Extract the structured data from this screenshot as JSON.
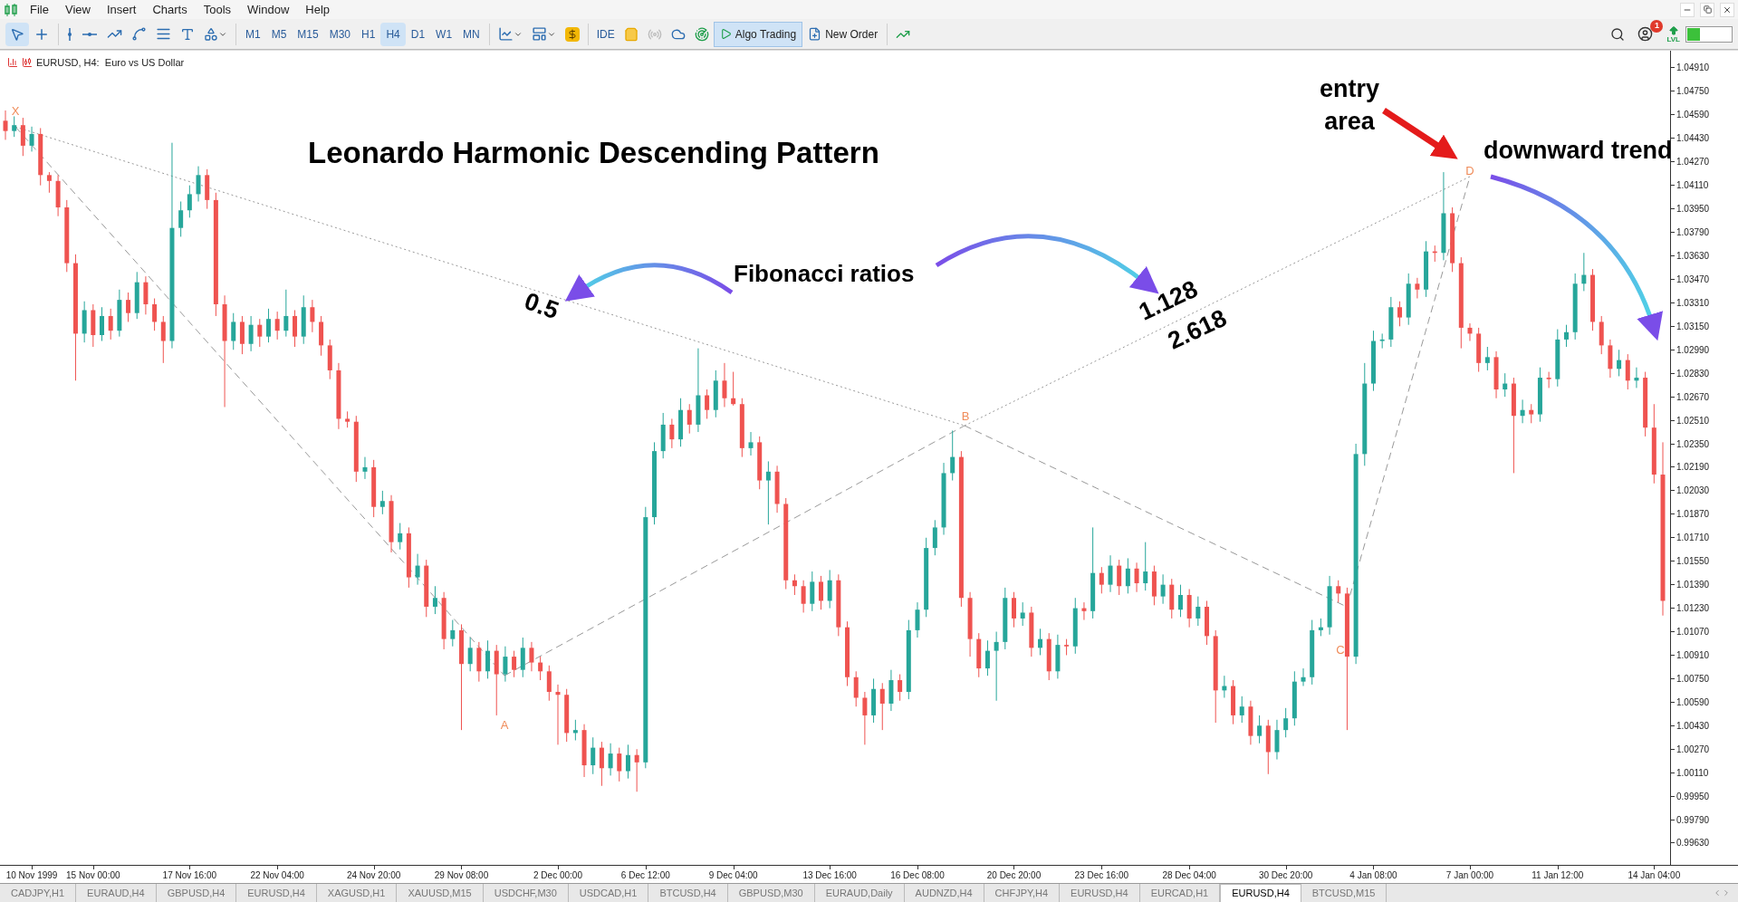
{
  "menu": [
    "File",
    "View",
    "Insert",
    "Charts",
    "Tools",
    "Window",
    "Help"
  ],
  "toolbar": {
    "timeframes": [
      {
        "label": "M1",
        "selected": false
      },
      {
        "label": "M5",
        "selected": false
      },
      {
        "label": "M15",
        "selected": false
      },
      {
        "label": "M30",
        "selected": false
      },
      {
        "label": "H1",
        "selected": false
      },
      {
        "label": "H4",
        "selected": true
      },
      {
        "label": "D1",
        "selected": false
      },
      {
        "label": "W1",
        "selected": false
      },
      {
        "label": "MN",
        "selected": false
      }
    ],
    "ide": "IDE",
    "algo_trading": {
      "label": "Algo Trading",
      "on": true
    },
    "new_order": "New Order",
    "notification_count": "1",
    "level_badge": "LVL",
    "meter": {
      "level": 0.3
    }
  },
  "chart": {
    "header": "EURUSD, H4:  Euro vs US Dollar",
    "title": "Leonardo Harmonic Descending Pattern",
    "fib_label": "Fibonacci ratios",
    "entry_label": [
      "entry",
      "area"
    ],
    "trend_label": "downward trend",
    "ratios": [
      "0.5",
      "1.128",
      "2.618"
    ],
    "points": [
      "X",
      "A",
      "B",
      "C",
      "D"
    ],
    "chart_data": {
      "type": "candlestick",
      "ylim": [
        0.99488,
        1.05027
      ],
      "categories": [
        null,
        null,
        null,
        "10 Nov 1999",
        null,
        null,
        null,
        null,
        null,
        null,
        "15 Nov 00:00",
        null,
        null,
        null,
        null,
        null,
        null,
        null,
        null,
        null,
        null,
        "17 Nov 16:00",
        null,
        null,
        null,
        null,
        null,
        null,
        null,
        null,
        null,
        "22 Nov 04:00",
        null,
        null,
        null,
        null,
        null,
        null,
        null,
        null,
        null,
        null,
        "24 Nov 20:00",
        null,
        null,
        null,
        null,
        null,
        null,
        null,
        null,
        null,
        "29 Nov 08:00",
        null,
        null,
        null,
        null,
        null,
        null,
        null,
        null,
        null,
        null,
        "2 Dec 00:00",
        null,
        null,
        null,
        null,
        null,
        null,
        null,
        null,
        null,
        "6 Dec 12:00",
        null,
        null,
        null,
        null,
        null,
        null,
        null,
        null,
        null,
        "9 Dec 04:00",
        null,
        null,
        null,
        null,
        null,
        null,
        null,
        null,
        null,
        null,
        "13 Dec 16:00",
        null,
        null,
        null,
        null,
        null,
        null,
        null,
        null,
        null,
        "16 Dec 08:00",
        null,
        null,
        null,
        null,
        null,
        null,
        null,
        null,
        null,
        null,
        "20 Dec 20:00",
        null,
        null,
        null,
        null,
        null,
        null,
        null,
        null,
        null,
        "23 Dec 16:00",
        null,
        null,
        null,
        null,
        null,
        null,
        null,
        null,
        null,
        "28 Dec 04:00",
        null,
        null,
        null,
        null,
        null,
        null,
        null,
        null,
        null,
        null,
        "30 Dec 20:00",
        null,
        null,
        null,
        null,
        null,
        null,
        null,
        null,
        null,
        "4 Jan 08:00",
        null,
        null,
        null,
        null,
        null,
        null,
        null,
        null,
        null,
        null,
        "7 Jan 00:00",
        null,
        null,
        null,
        null,
        null,
        null,
        null,
        null,
        null,
        "11 Jan 12:00",
        null,
        null,
        null,
        null,
        null,
        null,
        null,
        null,
        null,
        null,
        "14 Jan 04:00",
        null
      ],
      "yticks": [
        {
          "value": 1.0491,
          "label": "1.04910"
        },
        {
          "value": 1.0475,
          "label": "1.04750"
        },
        {
          "value": 1.0459,
          "label": "1.04590"
        },
        {
          "value": 1.0443,
          "label": "1.04430"
        },
        {
          "value": 1.0427,
          "label": "1.04270"
        },
        {
          "value": 1.0411,
          "label": "1.04110"
        },
        {
          "value": 1.0395,
          "label": "1.03950"
        },
        {
          "value": 1.0379,
          "label": "1.03790"
        },
        {
          "value": 1.0363,
          "label": "1.03630"
        },
        {
          "value": 1.0347,
          "label": "1.03470"
        },
        {
          "value": 1.0331,
          "label": "1.03310"
        },
        {
          "value": 1.0315,
          "label": "1.03150"
        },
        {
          "value": 1.0299,
          "label": "1.02990"
        },
        {
          "value": 1.0283,
          "label": "1.02830"
        },
        {
          "value": 1.0267,
          "label": "1.02670"
        },
        {
          "value": 1.0251,
          "label": "1.02510"
        },
        {
          "value": 1.0235,
          "label": "1.02350"
        },
        {
          "value": 1.0219,
          "label": "1.02190"
        },
        {
          "value": 1.0203,
          "label": "1.02030"
        },
        {
          "value": 1.0187,
          "label": "1.01870"
        },
        {
          "value": 1.0171,
          "label": "1.01710"
        },
        {
          "value": 1.0155,
          "label": "1.01550"
        },
        {
          "value": 1.0139,
          "label": "1.01390"
        },
        {
          "value": 1.0123,
          "label": "1.01230"
        },
        {
          "value": 1.0107,
          "label": "1.01070"
        },
        {
          "value": 1.0091,
          "label": "1.00910"
        },
        {
          "value": 1.0075,
          "label": "1.00750"
        },
        {
          "value": 1.0059,
          "label": "1.00590"
        },
        {
          "value": 1.0043,
          "label": "1.00430"
        },
        {
          "value": 1.0027,
          "label": "1.00270"
        },
        {
          "value": 1.0011,
          "label": "1.00110"
        },
        {
          "value": 0.9995,
          "label": "0.99950"
        },
        {
          "value": 0.9979,
          "label": "0.99790"
        },
        {
          "value": 0.9963,
          "label": "0.99630"
        }
      ],
      "ohlc": [
        [
          1.0455,
          1.0462,
          1.0442,
          1.0448
        ],
        [
          1.0448,
          1.0458,
          1.0444,
          1.0452
        ],
        [
          1.0452,
          1.0457,
          1.0431,
          1.0438
        ],
        [
          1.0438,
          1.0451,
          1.0434,
          1.0446
        ],
        [
          1.0446,
          1.045,
          1.0411,
          1.0418
        ],
        [
          1.0418,
          1.042,
          1.0406,
          1.0414
        ],
        [
          1.0414,
          1.0418,
          1.039,
          1.0396
        ],
        [
          1.0396,
          1.0401,
          1.0352,
          1.0358
        ],
        [
          1.0358,
          1.0364,
          1.0278,
          1.031
        ],
        [
          1.031,
          1.0332,
          1.0304,
          1.0326
        ],
        [
          1.0326,
          1.033,
          1.0301,
          1.0309
        ],
        [
          1.0309,
          1.0328,
          1.0305,
          1.0322
        ],
        [
          1.0322,
          1.0327,
          1.0306,
          1.0312
        ],
        [
          1.0312,
          1.034,
          1.0308,
          1.0333
        ],
        [
          1.0333,
          1.0338,
          1.0318,
          1.0324
        ],
        [
          1.0324,
          1.0352,
          1.032,
          1.0345
        ],
        [
          1.0345,
          1.0349,
          1.0323,
          1.033
        ],
        [
          1.033,
          1.0334,
          1.0312,
          1.0318
        ],
        [
          1.0318,
          1.0322,
          1.029,
          1.0305
        ],
        [
          1.0305,
          1.044,
          1.03,
          1.0382
        ],
        [
          1.0382,
          1.04,
          1.0376,
          1.0394
        ],
        [
          1.0394,
          1.0411,
          1.0389,
          1.0405
        ],
        [
          1.0405,
          1.0424,
          1.04,
          1.0418
        ],
        [
          1.0418,
          1.0422,
          1.0395,
          1.0401
        ],
        [
          1.0401,
          1.0406,
          1.0322,
          1.033
        ],
        [
          1.033,
          1.0336,
          1.026,
          1.0305
        ],
        [
          1.0305,
          1.0324,
          1.0299,
          1.0318
        ],
        [
          1.0318,
          1.0322,
          1.0296,
          1.0303
        ],
        [
          1.0303,
          1.0322,
          1.0298,
          1.0316
        ],
        [
          1.0316,
          1.032,
          1.0301,
          1.0308
        ],
        [
          1.0308,
          1.0327,
          1.0304,
          1.032
        ],
        [
          1.032,
          1.0325,
          1.0306,
          1.0312
        ],
        [
          1.0312,
          1.034,
          1.0308,
          1.0322
        ],
        [
          1.0322,
          1.0326,
          1.0301,
          1.0308
        ],
        [
          1.0308,
          1.0336,
          1.0303,
          1.0328
        ],
        [
          1.0328,
          1.0333,
          1.0311,
          1.0318
        ],
        [
          1.0318,
          1.0322,
          1.0295,
          1.0302
        ],
        [
          1.0302,
          1.0306,
          1.0279,
          1.0285
        ],
        [
          1.0285,
          1.029,
          1.0245,
          1.0252
        ],
        [
          1.0252,
          1.0257,
          1.0246,
          1.025
        ],
        [
          1.025,
          1.0254,
          1.0209,
          1.0216
        ],
        [
          1.0216,
          1.0226,
          1.0211,
          1.0219
        ],
        [
          1.0219,
          1.0224,
          1.0185,
          1.0192
        ],
        [
          1.0192,
          1.0203,
          1.0187,
          1.0196
        ],
        [
          1.0196,
          1.02,
          1.0161,
          1.0168
        ],
        [
          1.0168,
          1.0181,
          1.0163,
          1.0174
        ],
        [
          1.0174,
          1.0178,
          1.0137,
          1.0144
        ],
        [
          1.0144,
          1.016,
          1.0139,
          1.0152
        ],
        [
          1.0152,
          1.0156,
          1.0117,
          1.0124
        ],
        [
          1.0124,
          1.0138,
          1.0119,
          1.013
        ],
        [
          1.013,
          1.0134,
          1.0095,
          1.0102
        ],
        [
          1.0102,
          1.0115,
          1.0097,
          1.0108
        ],
        [
          1.0108,
          1.0112,
          1.004,
          1.0085
        ],
        [
          1.0085,
          1.0103,
          1.008,
          1.0096
        ],
        [
          1.0096,
          1.01,
          1.0073,
          1.008
        ],
        [
          1.008,
          1.0101,
          1.0075,
          1.0094
        ],
        [
          1.0094,
          1.0098,
          1.005,
          1.0078
        ],
        [
          1.0078,
          1.0097,
          1.0073,
          1.009
        ],
        [
          1.009,
          1.0094,
          1.0076,
          1.0081
        ],
        [
          1.0081,
          1.0103,
          1.0076,
          1.0096
        ],
        [
          1.0096,
          1.01,
          1.008,
          1.0086
        ],
        [
          1.0086,
          1.009,
          1.0074,
          1.008
        ],
        [
          1.008,
          1.0084,
          1.006,
          1.0066
        ],
        [
          1.0066,
          1.0071,
          1.003,
          1.0064
        ],
        [
          1.0064,
          1.0068,
          1.0032,
          1.0038
        ],
        [
          1.0038,
          1.0047,
          1.0033,
          1.004
        ],
        [
          1.004,
          1.0044,
          1.0008,
          1.0016
        ],
        [
          1.0016,
          1.0035,
          1.001,
          1.0028
        ],
        [
          1.0028,
          1.0032,
          1.0002,
          1.0014
        ],
        [
          1.0014,
          1.0031,
          1.0009,
          1.0024
        ],
        [
          1.0024,
          1.0028,
          1.0005,
          1.0012
        ],
        [
          1.0012,
          1.003,
          1.0007,
          1.0023
        ],
        [
          1.0023,
          1.0027,
          0.9998,
          1.0018
        ],
        [
          1.0018,
          1.0192,
          1.0014,
          1.0185
        ],
        [
          1.0185,
          1.0236,
          1.018,
          1.023
        ],
        [
          1.023,
          1.0256,
          1.0225,
          1.0248
        ],
        [
          1.0248,
          1.0252,
          1.0232,
          1.0238
        ],
        [
          1.0238,
          1.0266,
          1.0233,
          1.0258
        ],
        [
          1.0258,
          1.0262,
          1.0242,
          1.0248
        ],
        [
          1.0248,
          1.03,
          1.0243,
          1.0268
        ],
        [
          1.0268,
          1.0272,
          1.0252,
          1.0258
        ],
        [
          1.0258,
          1.0285,
          1.0253,
          1.0278
        ],
        [
          1.0278,
          1.029,
          1.026,
          1.0266
        ],
        [
          1.0266,
          1.0284,
          1.0261,
          1.0262
        ],
        [
          1.0262,
          1.0266,
          1.0226,
          1.0232
        ],
        [
          1.0232,
          1.0243,
          1.0227,
          1.0236
        ],
        [
          1.0236,
          1.024,
          1.0204,
          1.021
        ],
        [
          1.021,
          1.0223,
          1.018,
          1.0216
        ],
        [
          1.0216,
          1.022,
          1.0188,
          1.0194
        ],
        [
          1.0194,
          1.0198,
          1.0136,
          1.0142
        ],
        [
          1.0142,
          1.0146,
          1.0132,
          1.0138
        ],
        [
          1.0138,
          1.0142,
          1.012,
          1.0126
        ],
        [
          1.0126,
          1.0148,
          1.0121,
          1.0141
        ],
        [
          1.0141,
          1.0145,
          1.0122,
          1.0128
        ],
        [
          1.0128,
          1.0149,
          1.0123,
          1.0142
        ],
        [
          1.0142,
          1.0146,
          1.0104,
          1.011
        ],
        [
          1.011,
          1.0114,
          1.007,
          1.0076
        ],
        [
          1.0076,
          1.008,
          1.0056,
          1.0062
        ],
        [
          1.0062,
          1.0066,
          1.003,
          1.005
        ],
        [
          1.005,
          1.0075,
          1.0045,
          1.0068
        ],
        [
          1.0068,
          1.0072,
          1.004,
          1.0058
        ],
        [
          1.0058,
          1.0081,
          1.0053,
          1.0074
        ],
        [
          1.0074,
          1.0078,
          1.006,
          1.0066
        ],
        [
          1.0066,
          1.0115,
          1.0061,
          1.0108
        ],
        [
          1.0108,
          1.0127,
          1.0103,
          1.0122
        ],
        [
          1.0122,
          1.0171,
          1.0117,
          1.0164
        ],
        [
          1.0164,
          1.0183,
          1.0159,
          1.0178
        ],
        [
          1.0178,
          1.0222,
          1.0173,
          1.0215
        ],
        [
          1.0215,
          1.0244,
          1.021,
          1.0226
        ],
        [
          1.0226,
          1.023,
          1.0124,
          1.013
        ],
        [
          1.013,
          1.0134,
          1.009,
          1.0102
        ],
        [
          1.0102,
          1.0106,
          1.0076,
          1.0082
        ],
        [
          1.0082,
          1.0101,
          1.0077,
          1.0094
        ],
        [
          1.0094,
          1.0107,
          1.006,
          1.01
        ],
        [
          1.01,
          1.0137,
          1.0095,
          1.013
        ],
        [
          1.013,
          1.0134,
          1.011,
          1.0116
        ],
        [
          1.0116,
          1.0127,
          1.0111,
          1.012
        ],
        [
          1.012,
          1.0124,
          1.009,
          1.0096
        ],
        [
          1.0096,
          1.0109,
          1.0091,
          1.0102
        ],
        [
          1.0102,
          1.0106,
          1.0074,
          1.008
        ],
        [
          1.008,
          1.0105,
          1.0075,
          1.0098
        ],
        [
          1.0098,
          1.0102,
          1.0091,
          1.0097
        ],
        [
          1.0097,
          1.013,
          1.0092,
          1.0123
        ],
        [
          1.0123,
          1.0127,
          1.0115,
          1.0121
        ],
        [
          1.0121,
          1.0178,
          1.0116,
          1.0147
        ],
        [
          1.0147,
          1.0151,
          1.0133,
          1.0139
        ],
        [
          1.0139,
          1.0159,
          1.0134,
          1.0152
        ],
        [
          1.0152,
          1.0156,
          1.0132,
          1.0138
        ],
        [
          1.0138,
          1.0157,
          1.0133,
          1.015
        ],
        [
          1.015,
          1.0154,
          1.0134,
          1.014
        ],
        [
          1.014,
          1.0168,
          1.0135,
          1.0148
        ],
        [
          1.0148,
          1.0152,
          1.0125,
          1.0131
        ],
        [
          1.0131,
          1.0146,
          1.0126,
          1.0139
        ],
        [
          1.0139,
          1.0143,
          1.0116,
          1.0122
        ],
        [
          1.0122,
          1.0139,
          1.0117,
          1.0132
        ],
        [
          1.0132,
          1.0136,
          1.011,
          1.0116
        ],
        [
          1.0116,
          1.0131,
          1.0111,
          1.0124
        ],
        [
          1.0124,
          1.0128,
          1.0098,
          1.0104
        ],
        [
          1.0104,
          1.0108,
          1.0045,
          1.0067
        ],
        [
          1.0067,
          1.0077,
          1.0062,
          1.007
        ],
        [
          1.007,
          1.0074,
          1.0044,
          1.005
        ],
        [
          1.005,
          1.0063,
          1.0045,
          1.0056
        ],
        [
          1.0056,
          1.006,
          1.003,
          1.0036
        ],
        [
          1.0036,
          1.005,
          1.0031,
          1.0043
        ],
        [
          1.0043,
          1.0047,
          1.001,
          1.0025
        ],
        [
          1.0025,
          1.0047,
          1.002,
          1.004
        ],
        [
          1.004,
          1.0055,
          1.0035,
          1.0048
        ],
        [
          1.0048,
          1.008,
          1.0043,
          1.0073
        ],
        [
          1.0073,
          1.0082,
          1.007,
          1.0076
        ],
        [
          1.0076,
          1.0115,
          1.0071,
          1.0108
        ],
        [
          1.0108,
          1.0116,
          1.0104,
          1.011
        ],
        [
          1.011,
          1.0145,
          1.0105,
          1.0138
        ],
        [
          1.0138,
          1.0142,
          1.0127,
          1.0133
        ],
        [
          1.0133,
          1.0137,
          1.004,
          1.009
        ],
        [
          1.009,
          1.0235,
          1.0085,
          1.0228
        ],
        [
          1.0228,
          1.029,
          1.022,
          1.0276
        ],
        [
          1.0276,
          1.0312,
          1.0271,
          1.0305
        ],
        [
          1.0305,
          1.031,
          1.03,
          1.0306
        ],
        [
          1.0306,
          1.0335,
          1.0301,
          1.0328
        ],
        [
          1.0328,
          1.0332,
          1.0315,
          1.0321
        ],
        [
          1.0321,
          1.0351,
          1.0316,
          1.0344
        ],
        [
          1.0344,
          1.0348,
          1.0334,
          1.034
        ],
        [
          1.034,
          1.0373,
          1.0335,
          1.0366
        ],
        [
          1.0366,
          1.037,
          1.0359,
          1.0365
        ],
        [
          1.0365,
          1.042,
          1.036,
          1.0392
        ],
        [
          1.0392,
          1.0396,
          1.0352,
          1.0358
        ],
        [
          1.0358,
          1.0362,
          1.03,
          1.0314
        ],
        [
          1.0314,
          1.0317,
          1.0305,
          1.031
        ],
        [
          1.031,
          1.0314,
          1.0284,
          1.029
        ],
        [
          1.029,
          1.0301,
          1.0285,
          1.0294
        ],
        [
          1.0294,
          1.0298,
          1.0266,
          1.0272
        ],
        [
          1.0272,
          1.0283,
          1.0267,
          1.0276
        ],
        [
          1.0276,
          1.028,
          1.0215,
          1.0254
        ],
        [
          1.0254,
          1.0265,
          1.0249,
          1.0258
        ],
        [
          1.0258,
          1.0262,
          1.0249,
          1.0255
        ],
        [
          1.0255,
          1.0287,
          1.025,
          1.028
        ],
        [
          1.028,
          1.0284,
          1.0273,
          1.0279
        ],
        [
          1.0279,
          1.0313,
          1.0274,
          1.0306
        ],
        [
          1.0306,
          1.0316,
          1.0301,
          1.0311
        ],
        [
          1.0311,
          1.0351,
          1.0306,
          1.0344
        ],
        [
          1.0344,
          1.0365,
          1.0339,
          1.035
        ],
        [
          1.035,
          1.0354,
          1.0312,
          1.0318
        ],
        [
          1.0318,
          1.0322,
          1.0296,
          1.0302
        ],
        [
          1.0302,
          1.0306,
          1.028,
          1.0286
        ],
        [
          1.0286,
          1.0299,
          1.0281,
          1.0292
        ],
        [
          1.0292,
          1.0296,
          1.0272,
          1.0278
        ],
        [
          1.0278,
          1.0287,
          1.0273,
          1.028
        ],
        [
          1.028,
          1.0284,
          1.024,
          1.0246
        ],
        [
          1.0246,
          1.0262,
          1.0208,
          1.0214
        ],
        [
          1.0214,
          1.0236,
          1.0118,
          1.0128
        ]
      ]
    }
  },
  "tabs": [
    {
      "label": "CADJPY,H1",
      "selected": false
    },
    {
      "label": "EURAUD,H4",
      "selected": false
    },
    {
      "label": "GBPUSD,H4",
      "selected": false
    },
    {
      "label": "EURUSD,H4",
      "selected": false
    },
    {
      "label": "XAGUSD,H1",
      "selected": false
    },
    {
      "label": "XAUUSD,M15",
      "selected": false
    },
    {
      "label": "USDCHF,M30",
      "selected": false
    },
    {
      "label": "USDCAD,H1",
      "selected": false
    },
    {
      "label": "BTCUSD,H4",
      "selected": false
    },
    {
      "label": "GBPUSD,M30",
      "selected": false
    },
    {
      "label": "EURAUD,Daily",
      "selected": false
    },
    {
      "label": "AUDNZD,H4",
      "selected": false
    },
    {
      "label": "CHFJPY,H4",
      "selected": false
    },
    {
      "label": "EURUSD,H4",
      "selected": false
    },
    {
      "label": "EURCAD,H1",
      "selected": false
    },
    {
      "label": "EURUSD,H4",
      "selected": true
    },
    {
      "label": "BTCUSD,M15",
      "selected": false
    }
  ]
}
